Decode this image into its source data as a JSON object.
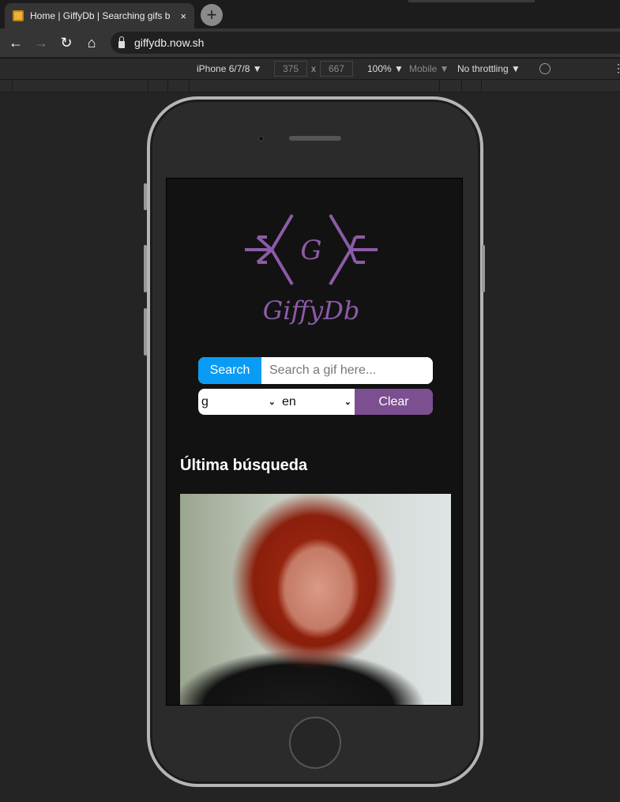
{
  "browser": {
    "tab_title": "Home | GiffyDb | Searching gifs b",
    "tab_close": "×",
    "new_tab": "+",
    "url": "giffydb.now.sh",
    "nav": {
      "back": "←",
      "forward": "→",
      "reload": "↻",
      "home": "⌂"
    }
  },
  "devtools": {
    "device": "iPhone 6/7/8 ▼",
    "width": "375",
    "times": "x",
    "height": "667",
    "zoom": "100% ▼",
    "mode": "Mobile ▼",
    "throttling": "No throttling ▼",
    "rotate_icon": "⃠",
    "more": "⋮"
  },
  "app": {
    "logo_letter": "G",
    "logo_text": "GiffyDb",
    "brand_color": "#8c5ba8",
    "search_button": "Search",
    "search_placeholder": "Search a gif here...",
    "rating_select": "g",
    "language_select": "en",
    "clear_button": "Clear",
    "section_title": "Última búsqueda"
  }
}
